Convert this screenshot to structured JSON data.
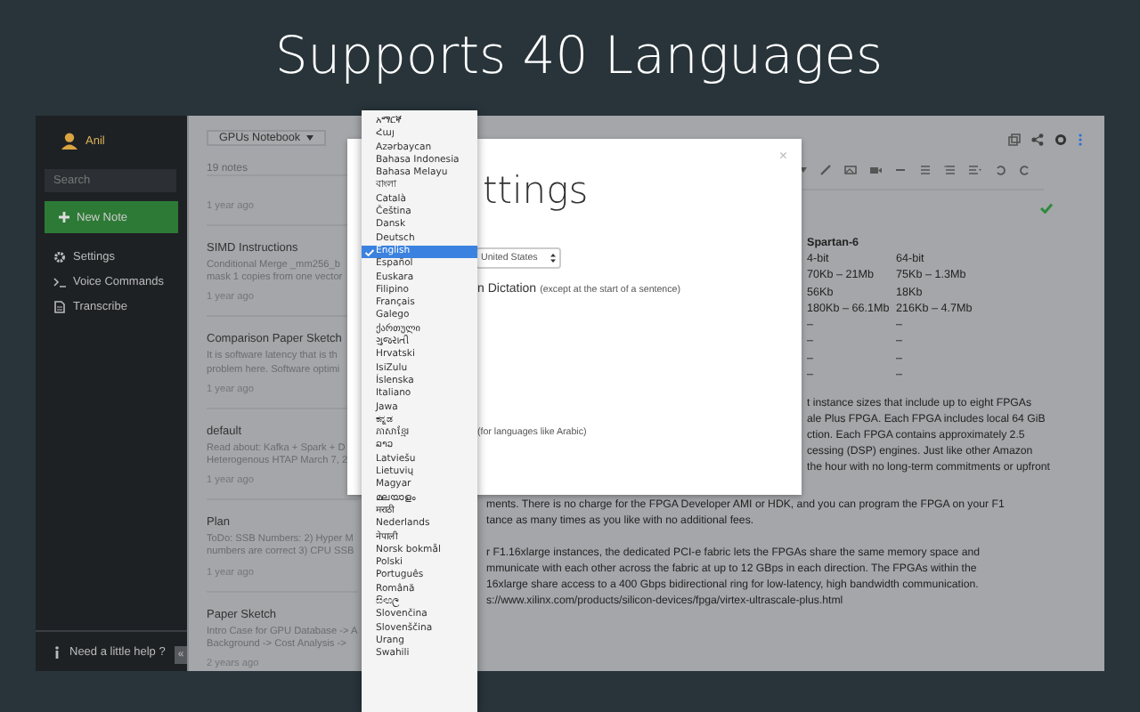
{
  "headline": "Supports 40 Languages",
  "sidebar": {
    "user": "Anil",
    "search": {
      "placeholder": "Search"
    },
    "new_note": "New Note",
    "items": [
      {
        "label": "Settings"
      },
      {
        "label": "Voice Commands"
      },
      {
        "label": "Transcribe"
      }
    ],
    "help": "Need a little help ?",
    "collapse": "«"
  },
  "notes": {
    "notebook": "GPUs Notebook",
    "count": "19 notes",
    "items": [
      {
        "time": "1 year ago"
      },
      {
        "title": "SIMD Instructions",
        "preview": [
          "Conditional Merge _mm256_b",
          "mask 1 copies from one vector"
        ],
        "time": "1 year ago"
      },
      {
        "title": "Comparison Paper Sketch",
        "preview": [
          "It is software latency that is th",
          "problem here. Software optimi"
        ],
        "time": "1 year ago"
      },
      {
        "title": "default",
        "preview": [
          "Read about: Kafka + Spark + D",
          "Heterogenous HTAP March 7, 2"
        ],
        "time": "1 year ago"
      },
      {
        "title": "Plan",
        "preview": [
          "ToDo: SSB Numbers: 2) Hyper M",
          "numbers are correct 3) CPU SSB"
        ],
        "time": "1 year ago"
      },
      {
        "title": "Paper Sketch",
        "preview": [
          "Intro Case for GPU Database -> A",
          "Background -> Cost Analysis ->"
        ],
        "time": "2 years ago"
      }
    ]
  },
  "editor": {
    "table": {
      "header": "Spartan-6",
      "rows": [
        [
          "4-bit",
          "64-bit"
        ],
        [
          "70Kb – 21Mb",
          "75Kb – 1.3Mb"
        ],
        [
          "56Kb",
          "18Kb"
        ],
        [
          "180Kb – 66.1Mb",
          "216Kb – 4.7Mb"
        ],
        [
          "–",
          "–"
        ],
        [
          "–",
          "–"
        ],
        [
          "–",
          "–"
        ],
        [
          "–",
          "–"
        ]
      ]
    },
    "lines_beside": [
      "t instance sizes that include up to eight FPGAs",
      "ale Plus FPGA. Each FPGA includes local 64 GiB",
      "ction. Each FPGA contains approximately 2.5",
      "cessing (DSP) engines. Just like other Amazon",
      "the hour with no long-term commitments or upfront"
    ],
    "paragraphs_below": [
      [
        "ments. There is no charge for the FPGA Developer AMI or HDK, and you can program the FPGA on your F1",
        "tance as many times as you like with no additional fees."
      ],
      [
        "r F1.16xlarge instances, the dedicated PCI-e fabric lets the FPGAs share the same memory space and",
        "mmunicate with each other across the fabric at up to 12 GBps in each direction. The FPGAs within the",
        "16xlarge share access to a 400 Gbps bidirectional ring for low-latency, high bandwidth communication.",
        "s://www.xilinx.com/products/silicon-devices/fpga/virtex-ultrascale-plus.html"
      ]
    ]
  },
  "dialog": {
    "title": "ttings",
    "close": "×",
    "select_value": "United States",
    "option_label": "n Dictation",
    "option_hint": "(except at the start of a sentence)",
    "note": "(for languages like Arabic)"
  },
  "dropdown": {
    "items": [
      {
        "label": "አማርኛ",
        "selected": false
      },
      {
        "label": "Հայ",
        "selected": false
      },
      {
        "label": "Azərbaycan",
        "selected": false
      },
      {
        "label": "Bahasa Indonesia",
        "selected": false
      },
      {
        "label": "Bahasa Melayu",
        "selected": false
      },
      {
        "label": "বাংলা",
        "selected": false
      },
      {
        "label": "Català",
        "selected": false
      },
      {
        "label": "Čeština",
        "selected": false
      },
      {
        "label": "Dansk",
        "selected": false
      },
      {
        "label": "Deutsch",
        "selected": false
      },
      {
        "label": "English",
        "selected": true
      },
      {
        "label": "Español",
        "selected": false
      },
      {
        "label": "Euskara",
        "selected": false
      },
      {
        "label": "Filipino",
        "selected": false
      },
      {
        "label": "Français",
        "selected": false
      },
      {
        "label": "Galego",
        "selected": false
      },
      {
        "label": "ქართული",
        "selected": false
      },
      {
        "label": "ગુજરાતી",
        "selected": false
      },
      {
        "label": "Hrvatski",
        "selected": false
      },
      {
        "label": "IsiZulu",
        "selected": false
      },
      {
        "label": "Íslenska",
        "selected": false
      },
      {
        "label": "Italiano",
        "selected": false
      },
      {
        "label": "Jawa",
        "selected": false
      },
      {
        "label": "ಕನ್ನಡ",
        "selected": false
      },
      {
        "label": "ភាសាខ្មែរ",
        "selected": false
      },
      {
        "label": "ລາວ",
        "selected": false
      },
      {
        "label": "Latviešu",
        "selected": false
      },
      {
        "label": "Lietuvių",
        "selected": false
      },
      {
        "label": "Magyar",
        "selected": false
      },
      {
        "label": "മലയാളം",
        "selected": false
      },
      {
        "label": "मराठी",
        "selected": false
      },
      {
        "label": "Nederlands",
        "selected": false
      },
      {
        "label": "नेपाली",
        "selected": false
      },
      {
        "label": "Norsk bokmål",
        "selected": false
      },
      {
        "label": "Polski",
        "selected": false
      },
      {
        "label": "Português",
        "selected": false
      },
      {
        "label": "Română",
        "selected": false
      },
      {
        "label": "සිංහල",
        "selected": false
      },
      {
        "label": "Slovenčina",
        "selected": false
      },
      {
        "label": "Slovenščina",
        "selected": false
      },
      {
        "label": "Urang",
        "selected": false
      },
      {
        "label": "Swahili",
        "selected": false
      }
    ]
  }
}
